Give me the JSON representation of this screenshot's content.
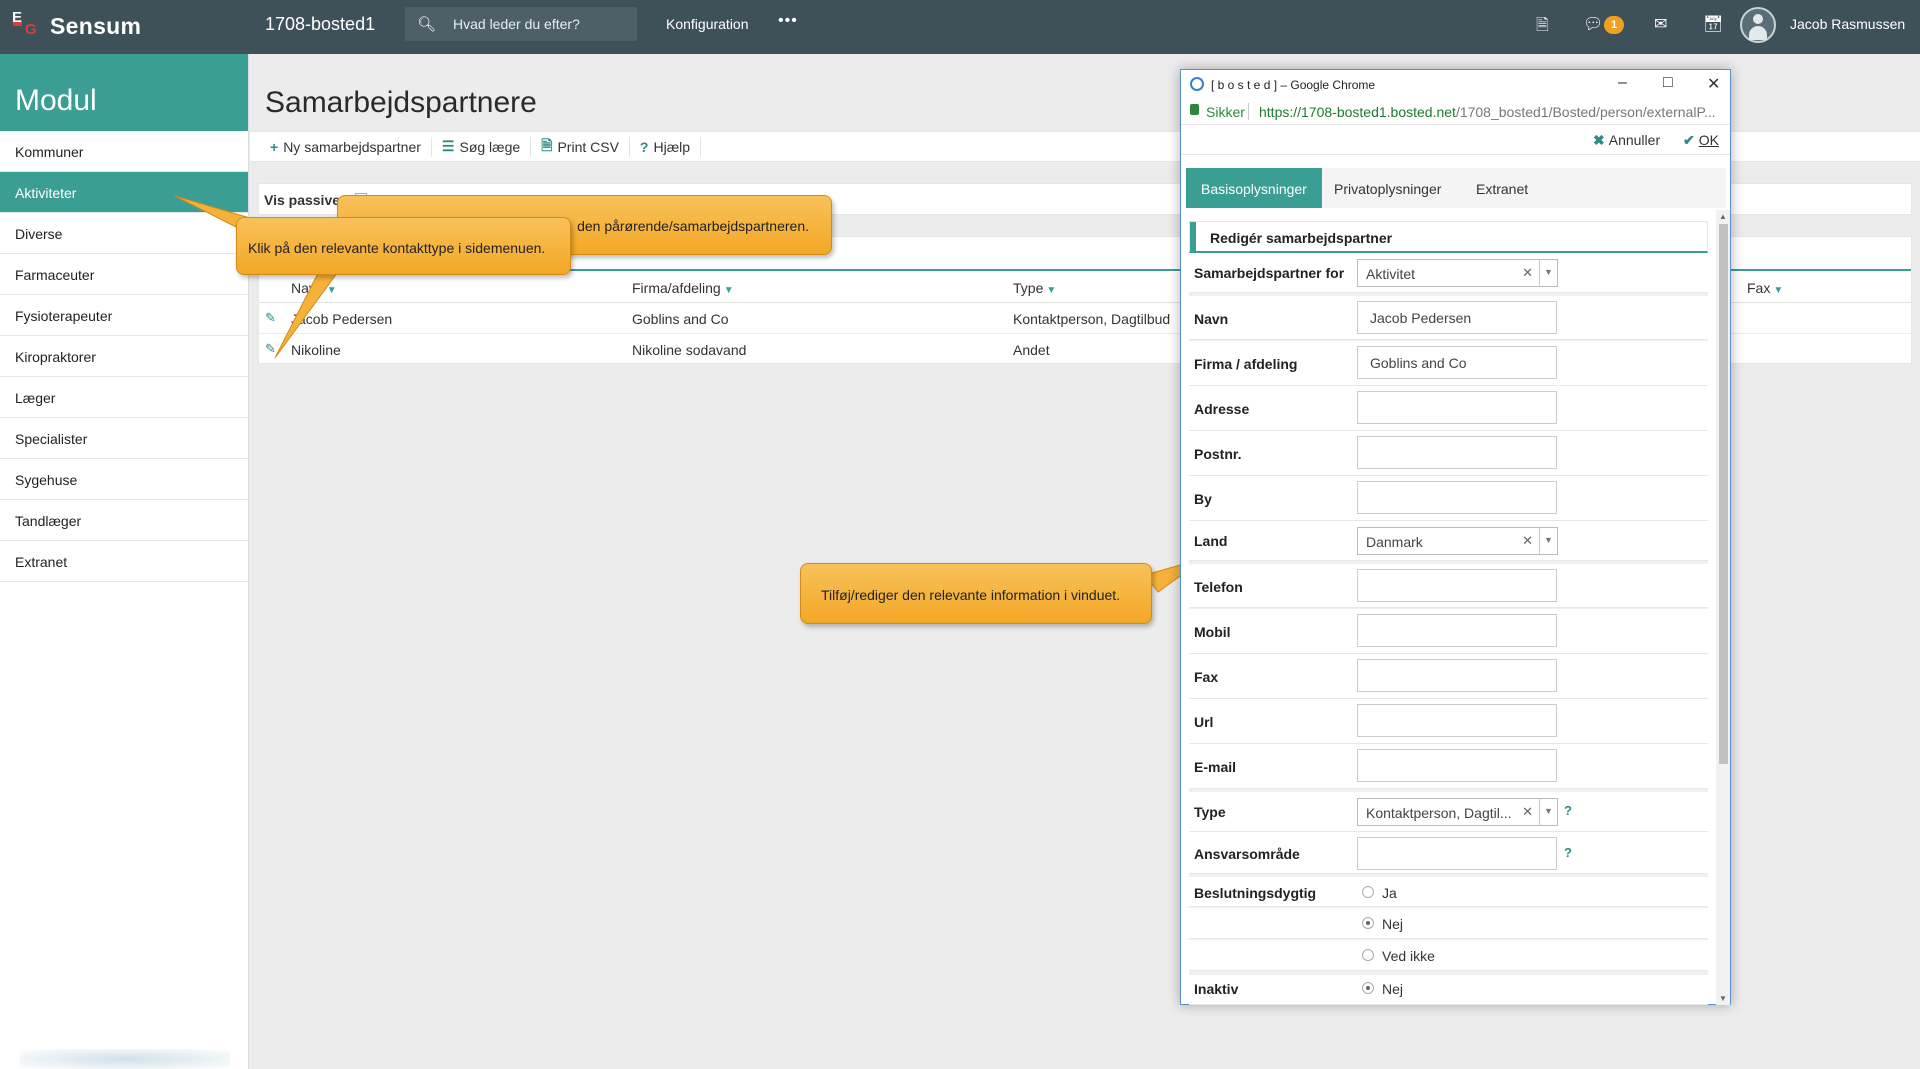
{
  "app": {
    "brand": "Sensum",
    "instance": "1708-bosted1",
    "search_placeholder": "Hvad leder du efter?",
    "config_label": "Konfiguration",
    "more_label": "•••",
    "notification_count": "1",
    "user_name": "Jacob Rasmussen"
  },
  "sidebar": {
    "title": "Modul",
    "items": [
      {
        "label": "Kommuner"
      },
      {
        "label": "Aktiviteter"
      },
      {
        "label": "Diverse"
      },
      {
        "label": "Farmaceuter"
      },
      {
        "label": "Fysioterapeuter"
      },
      {
        "label": "Kiropraktorer"
      },
      {
        "label": "Læger"
      },
      {
        "label": "Specialister"
      },
      {
        "label": "Sygehuse"
      },
      {
        "label": "Tandlæger"
      },
      {
        "label": "Extranet"
      }
    ],
    "active_index": 1
  },
  "main": {
    "title": "Samarbejdspartnere",
    "toolbar": {
      "new_label": "Ny samarbejdspartner",
      "search_label": "Søg læge",
      "print_label": "Print CSV",
      "help_label": "Hjælp"
    },
    "filter_label": "Vis passive",
    "table": {
      "columns": [
        "Navn",
        "Firma/afdeling",
        "Type",
        "Fax"
      ],
      "rows": [
        {
          "navn": "Jacob Pedersen",
          "firma": "Goblins and Co",
          "type": "Kontaktperson, Dagtilbud"
        },
        {
          "navn": "Nikoline",
          "firma": "Nikoline sodavand",
          "type": "Andet"
        }
      ]
    }
  },
  "callouts": {
    "sidemenu": "Klik på den relevante kontakttype i sidemenuen.",
    "partial": "den pårørende/samarbejdspartneren.",
    "window": "Tilføj/rediger den relevante information i vinduet."
  },
  "popup": {
    "window_title": "[ b o s t e d ] – Google Chrome",
    "secure_label": "Sikker",
    "url_host": "https://1708-bosted1.bosted.net",
    "url_path": "/1708_bosted1/Bosted/person/externalP...",
    "cancel_label": "Annuller",
    "ok_label": "OK",
    "tabs": [
      "Basisoplysninger",
      "Privatoplysninger",
      "Extranet"
    ],
    "active_tab": 0,
    "form_title": "Redigér samarbejdspartner",
    "fields": {
      "partner_for": {
        "label": "Samarbejdspartner for",
        "value": "Aktivitet"
      },
      "navn": {
        "label": "Navn",
        "value": "Jacob Pedersen"
      },
      "firma": {
        "label": "Firma / afdeling",
        "value": "Goblins and Co"
      },
      "adresse": {
        "label": "Adresse",
        "value": ""
      },
      "postnr": {
        "label": "Postnr.",
        "value": ""
      },
      "by": {
        "label": "By",
        "value": ""
      },
      "land": {
        "label": "Land",
        "value": "Danmark"
      },
      "telefon": {
        "label": "Telefon",
        "value": ""
      },
      "mobil": {
        "label": "Mobil",
        "value": ""
      },
      "fax": {
        "label": "Fax",
        "value": ""
      },
      "url": {
        "label": "Url",
        "value": ""
      },
      "email": {
        "label": "E-mail",
        "value": ""
      },
      "type": {
        "label": "Type",
        "value": "Kontaktperson, Dagtil..."
      },
      "ansvar": {
        "label": "Ansvarsområde",
        "value": ""
      },
      "beslutning": {
        "label": "Beslutningsdygtig",
        "options": [
          "Ja",
          "Nej",
          "Ved ikke"
        ],
        "selected": "Nej"
      },
      "inaktiv": {
        "label": "Inaktiv",
        "option": "Nej"
      }
    }
  },
  "colors": {
    "teal": "#3a9e94",
    "topbar": "#3e5058",
    "callout": "#f3a826",
    "badge": "#f0a020"
  }
}
